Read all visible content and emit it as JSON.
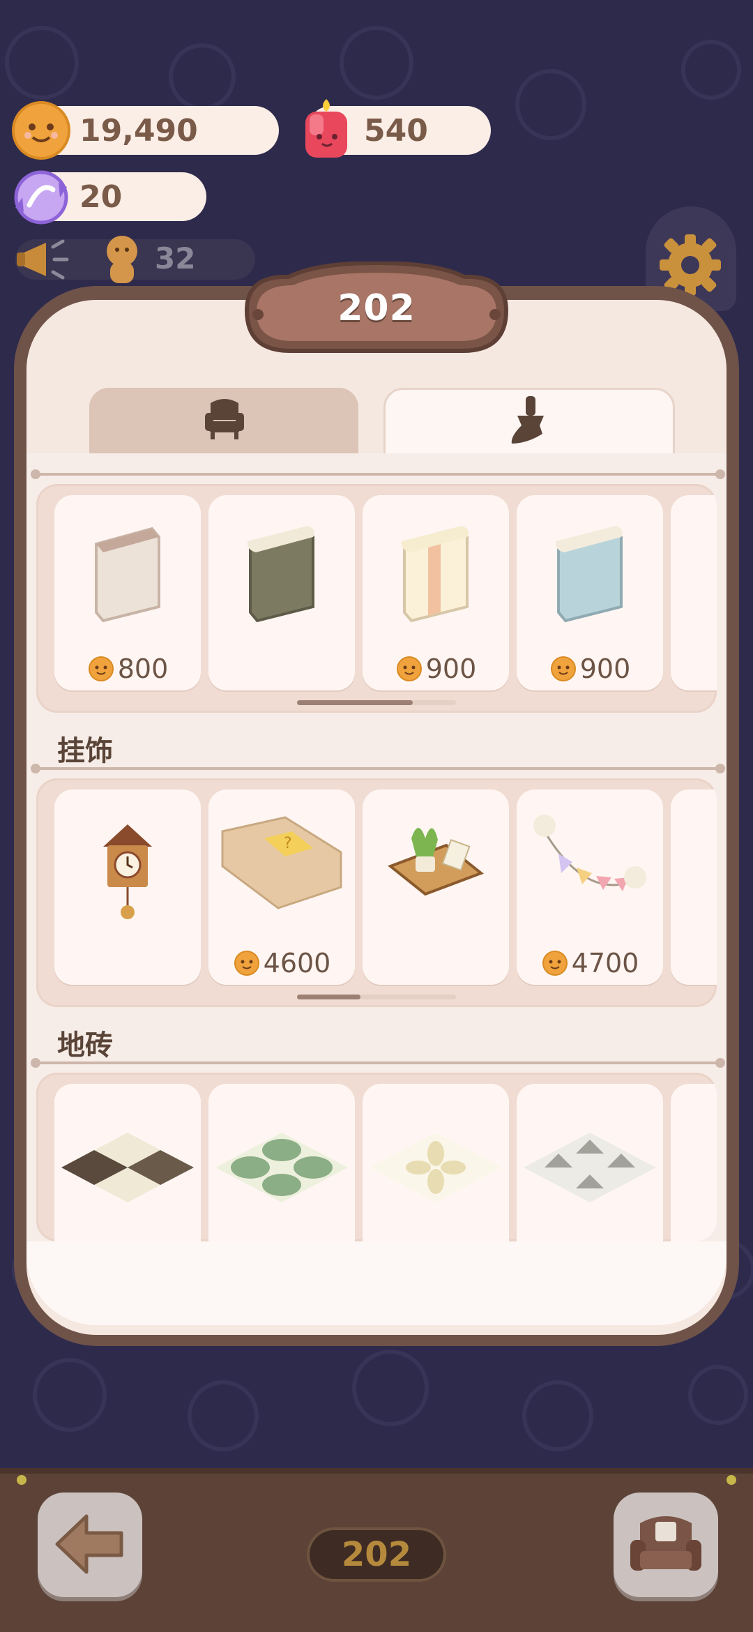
{
  "currencies": {
    "cookies": {
      "value": "19,490",
      "icon": "cookie-coin-icon"
    },
    "candle": {
      "value": "540",
      "icon": "red-candle-icon"
    },
    "gems": {
      "value": "20",
      "icon": "crystal-candy-icon"
    }
  },
  "ticker": {
    "count": "32",
    "icon": "megaphone-icon"
  },
  "panel": {
    "title": "202",
    "tabs": [
      {
        "name": "furniture",
        "icon": "armchair-icon"
      },
      {
        "name": "decor",
        "icon": "brush-icon"
      }
    ]
  },
  "sections": [
    {
      "title": "",
      "items": [
        {
          "icon": "white-panel-icon",
          "price": "800"
        },
        {
          "icon": "olive-panel-icon",
          "price": ""
        },
        {
          "icon": "striped-panel-icon",
          "price": "900"
        },
        {
          "icon": "blue-panel-icon",
          "price": "900"
        }
      ]
    },
    {
      "title": "挂饰",
      "items": [
        {
          "icon": "cuckoo-clock-icon",
          "price": ""
        },
        {
          "icon": "wall-shelf-icon",
          "price": "4600"
        },
        {
          "icon": "plant-shelf-icon",
          "price": ""
        },
        {
          "icon": "bunting-flags-icon",
          "price": "4700"
        }
      ]
    },
    {
      "title": "地砖",
      "items": [
        {
          "icon": "checker-tile-icon",
          "price": ""
        },
        {
          "icon": "green-circle-tile-icon",
          "price": ""
        },
        {
          "icon": "floral-tile-icon",
          "price": ""
        },
        {
          "icon": "triangle-tile-icon",
          "price": ""
        }
      ]
    }
  ],
  "bottom": {
    "level": "202",
    "back_icon": "back-arrow-icon",
    "sofa_icon": "sofa-icon"
  },
  "scroll": {
    "shelf1": 0.73,
    "shelf2": 0.4
  },
  "colors": {
    "background": "#2e2a4c",
    "panel": "#6f5349",
    "accent": "#b68a3c"
  }
}
